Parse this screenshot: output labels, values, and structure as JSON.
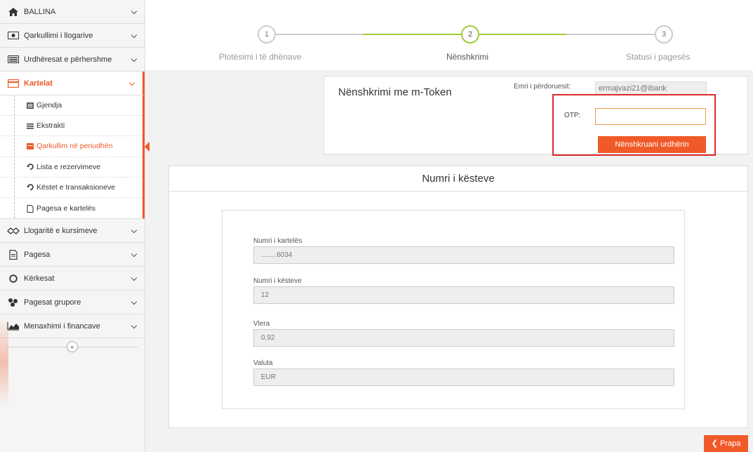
{
  "sidebar": {
    "items": [
      {
        "label": "BALLINA",
        "icon": "home-icon"
      },
      {
        "label": "Qarkullimi i llogarive",
        "icon": "eye-icon"
      },
      {
        "label": "Urdhëresat e përhershme",
        "icon": "list-icon"
      },
      {
        "label": "Kartelat",
        "icon": "card-icon"
      }
    ],
    "submenu": [
      {
        "label": "Gjendja",
        "icon": "balance-icon"
      },
      {
        "label": "Ekstrakti",
        "icon": "list-icon"
      },
      {
        "label": "Qarkullim në periudhën",
        "icon": "calendar-icon"
      },
      {
        "label": "Lista e rezervimeve",
        "icon": "history-icon"
      },
      {
        "label": "Këstet e transaksioneve",
        "icon": "history-icon"
      },
      {
        "label": "Pagesa e kartelës",
        "icon": "document-icon"
      }
    ],
    "items_after": [
      {
        "label": "Llogaritë e kursimeve",
        "icon": "handshake-icon"
      },
      {
        "label": "Pagesa",
        "icon": "document-icon"
      },
      {
        "label": "Kërkesat",
        "icon": "circle-icon"
      },
      {
        "label": "Pagesat grupore",
        "icon": "group-icon"
      },
      {
        "label": "Menaxhimi i financave",
        "icon": "chart-icon"
      }
    ],
    "collapse": "«"
  },
  "stepper": {
    "steps": [
      {
        "number": "1",
        "label": "Plotësimi i të dhënave"
      },
      {
        "number": "2",
        "label": "Nënshkrimi"
      },
      {
        "number": "3",
        "label": "Statusi i pagesës"
      }
    ],
    "active_step": 2,
    "active_color": "#a2cc3a"
  },
  "signing": {
    "title": "Nënshkrimi me m-Token",
    "user_label": "Emri i përdoruesit:",
    "user_value": "ermajvazi21@ibank",
    "otp_label": "OTP:",
    "otp_value": "",
    "sign_button": "Nënshkruani urdhërin"
  },
  "details": {
    "title": "Numri i kësteve",
    "fields": [
      {
        "label": "Numri i kartelës",
        "value": "........6034"
      },
      {
        "label": "Numri i kësteve",
        "value": "12"
      },
      {
        "label": "Vlera",
        "value": "0,92"
      },
      {
        "label": "Valuta",
        "value": "EUR"
      }
    ]
  },
  "back_button": "Prapa",
  "colors": {
    "accent": "#f05a28",
    "highlight": "#e02a2a",
    "step": "#a2cc3a"
  }
}
